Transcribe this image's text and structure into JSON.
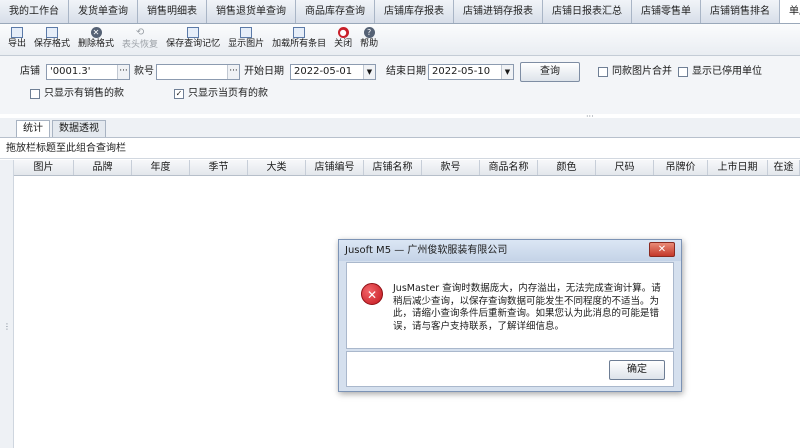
{
  "module_tabs": [
    {
      "label": "我的工作台",
      "active": false
    },
    {
      "label": "发货单查询",
      "active": false
    },
    {
      "label": "销售明细表",
      "active": false
    },
    {
      "label": "销售退货单查询",
      "active": false
    },
    {
      "label": "商品库存查询",
      "active": false
    },
    {
      "label": "店铺库存报表",
      "active": false
    },
    {
      "label": "店铺进销存报表",
      "active": false
    },
    {
      "label": "店铺日报表汇总",
      "active": false
    },
    {
      "label": "店铺零售单",
      "active": false
    },
    {
      "label": "店铺销售排名",
      "active": false
    },
    {
      "label": "单店畅销分析",
      "active": true
    }
  ],
  "toolbar": {
    "items": [
      {
        "icon": "export-icon",
        "label": "导出",
        "disabled": false
      },
      {
        "icon": "save-format-icon",
        "label": "保存格式",
        "disabled": false
      },
      {
        "icon": "delete-format-icon",
        "label": "删除格式",
        "disabled": false
      },
      {
        "icon": "restore-icon",
        "label": "表头恢复",
        "disabled": true
      },
      {
        "icon": "save-query-icon",
        "label": "保存查询记忆",
        "disabled": false
      },
      {
        "icon": "show-image-icon",
        "label": "显示图片",
        "disabled": false
      },
      {
        "icon": "load-all-icon",
        "label": "加载所有条目",
        "disabled": false
      },
      {
        "icon": "close-icon",
        "label": "关闭",
        "disabled": false
      },
      {
        "icon": "help-icon",
        "label": "帮助",
        "disabled": false
      }
    ]
  },
  "filters": {
    "store_label": "店铺",
    "store_value": "'0001.3'",
    "style_label": "款号",
    "style_value": "",
    "start_date_label": "开始日期",
    "start_date_value": "2022-05-01",
    "end_date_label": "结束日期",
    "end_date_value": "2022-05-10",
    "query_button": "查询",
    "same_image_merge": "同款图片合并",
    "show_disabled_units": "显示已停用单位",
    "only_valid_sales": "只显示有销售的款",
    "only_cur_rows": "只显示当页有的款"
  },
  "sub_tabs": [
    {
      "label": "统计",
      "active": true
    },
    {
      "label": "数据透视",
      "active": false
    }
  ],
  "group_hint": "拖放栏标题至此组合查询栏",
  "grid_columns": [
    {
      "label": "图片",
      "width": 60
    },
    {
      "label": "品牌",
      "width": 58
    },
    {
      "label": "年度",
      "width": 58
    },
    {
      "label": "季节",
      "width": 58
    },
    {
      "label": "大类",
      "width": 58
    },
    {
      "label": "店铺编号",
      "width": 58
    },
    {
      "label": "店铺名称",
      "width": 58
    },
    {
      "label": "款号",
      "width": 58
    },
    {
      "label": "商品名称",
      "width": 58
    },
    {
      "label": "颜色",
      "width": 58
    },
    {
      "label": "尺码",
      "width": 58
    },
    {
      "label": "吊牌价",
      "width": 54
    },
    {
      "label": "上市日期",
      "width": 60
    },
    {
      "label": "在途",
      "width": 32
    }
  ],
  "dialog": {
    "title": "Jusoft M5 — 广州俊软服装有限公司",
    "close_label": "✕",
    "message": "JusMaster 查询时数据庞大，内存溢出，无法完成查询计算。请稍后减少查询，以保存查询数据可能发生不同程度的不适当。为此，请缩小查询条件后重新查询。如果您认为此消息的可能是错误，请与客户支持联系，了解详细信息。",
    "ok_label": "确定"
  }
}
